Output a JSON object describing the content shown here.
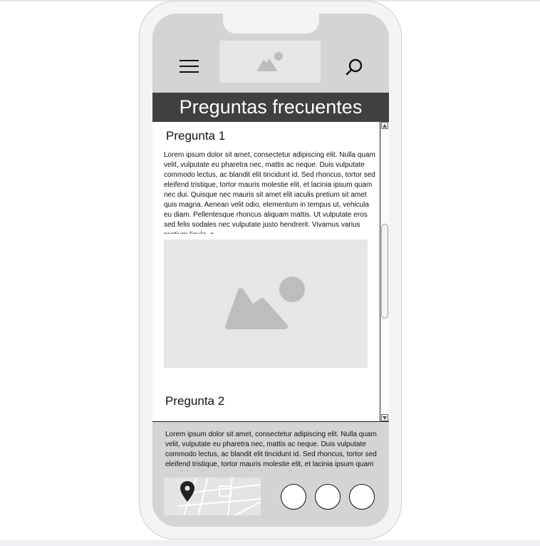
{
  "page": {
    "title": "Preguntas frecuentes"
  },
  "header": {
    "menu_icon": "hamburger-menu-icon",
    "logo_icon": "image-placeholder-icon",
    "search_icon": "search-icon"
  },
  "faq": [
    {
      "question": "Pregunta 1",
      "answer": "Lorem ipsum dolor sit amet, consectetur adipiscing elit. Nulla quam velit, vulputate eu pharetra nec, mattis ac neque. Duis vulputate commodo lectus, ac blandit elit tincidunt id. Sed rhoncus, tortor sed eleifend tristique, tortor mauris molestie elit, et lacinia ipsum quam nec dui. Quisque nec mauris sit amet elit iaculis pretium sit amet quis magna. Aenean velit odio, elementum in tempus ut, vehicula eu diam. Pellentesque rhoncus aliquam mattis. Ut vulputate eros sed felis sodales nec vulputate justo hendrerit. Vivamus varius pretium ligula, a"
    },
    {
      "question": "Pregunta 2",
      "answer": "Lorem ipsum dolor sit amet, consectetur adipiscing elit. Nulla quam velit, vulputate eu pharetra nec, mattis ac neque. Duis vulputate commodo lectus, ac blandit elit tincidunt id. Sed rhoncus, tortor sed eleifend tristique, tortor mauris molestie elit, et lacinia ipsum quam nec dui. Quisque nec mauris sit amet elit"
    }
  ],
  "footer": {
    "map_icon": "map-pin-icon",
    "buttons": [
      "circle-button",
      "circle-button",
      "circle-button"
    ]
  },
  "colors": {
    "title_bar": "#404040",
    "placeholder": "#e6e6e6",
    "placeholder_shape": "#bdbdbd"
  }
}
